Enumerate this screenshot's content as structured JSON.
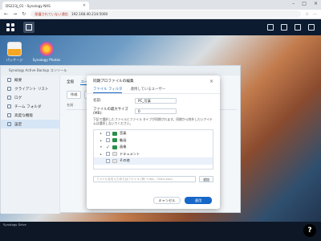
{
  "browser": {
    "tab_title": "DS223j_01 - Synology NAS",
    "tab_close": "×",
    "window_controls": [
      "–",
      "□",
      "×"
    ],
    "security_warning": "保護されていない通信",
    "url": "192.168.40.214:5000",
    "nav": [
      "←",
      "→",
      "↻"
    ]
  },
  "desktop": {
    "icons": [
      {
        "label": "パッケージ"
      },
      {
        "label": "Synology Photos"
      }
    ],
    "strip_label": "Synology Drive"
  },
  "app": {
    "title": "Synology Active Backup コンソール",
    "sidebar": [
      {
        "label": "概要",
        "active": false
      },
      {
        "label": "クライアント リスト",
        "active": false
      },
      {
        "label": "ログ",
        "active": false
      },
      {
        "label": "チーム フォルダ",
        "active": false
      },
      {
        "label": "高度な機能",
        "active": false
      },
      {
        "label": "設定",
        "active": true
      }
    ],
    "tabs": [
      "全般",
      "ユーザー"
    ],
    "toolbar": [
      "作成",
      "ファイル"
    ],
    "table_header": "名前"
  },
  "modal": {
    "title": "同期プロファイルの編集",
    "close": "×",
    "tabs": [
      {
        "label": "ファイル フィルタ",
        "active": true
      },
      {
        "label": "適用しているユーザー",
        "active": false
      }
    ],
    "name_label": "名前:",
    "name_value": "PC_写真",
    "max_size_label": "ファイルの最大サイズ (MB):",
    "max_size_value": "0",
    "hint": "下記で選択したファイルとファイル タイプが同期されます。同期から除外したいアイテムは選択しないでください。",
    "tree": [
      {
        "label": "音楽",
        "expander": "▸",
        "checked": false,
        "selected": false,
        "color": "#2a8f4a"
      },
      {
        "label": "動画",
        "expander": "▸",
        "checked": false,
        "selected": false,
        "color": "#2a8f4a"
      },
      {
        "label": "画像",
        "expander": "▾",
        "checked": true,
        "selected": false,
        "color": "#2a8f4a"
      },
      {
        "label": "ドキュメント",
        "expander": "▸",
        "checked": false,
        "selected": false,
        "color": "#e8e8e8"
      },
      {
        "label": "その他",
        "expander": "",
        "checked": false,
        "selected": true,
        "color": "#e8e8e8"
      }
    ],
    "search_placeholder": "ファイル名を入力またはファイル (例: *.doc、Chart.xlsx)",
    "browse_label": "追加",
    "cancel_label": "キャンセル",
    "apply_label": "適用"
  },
  "help_fab": "?"
}
